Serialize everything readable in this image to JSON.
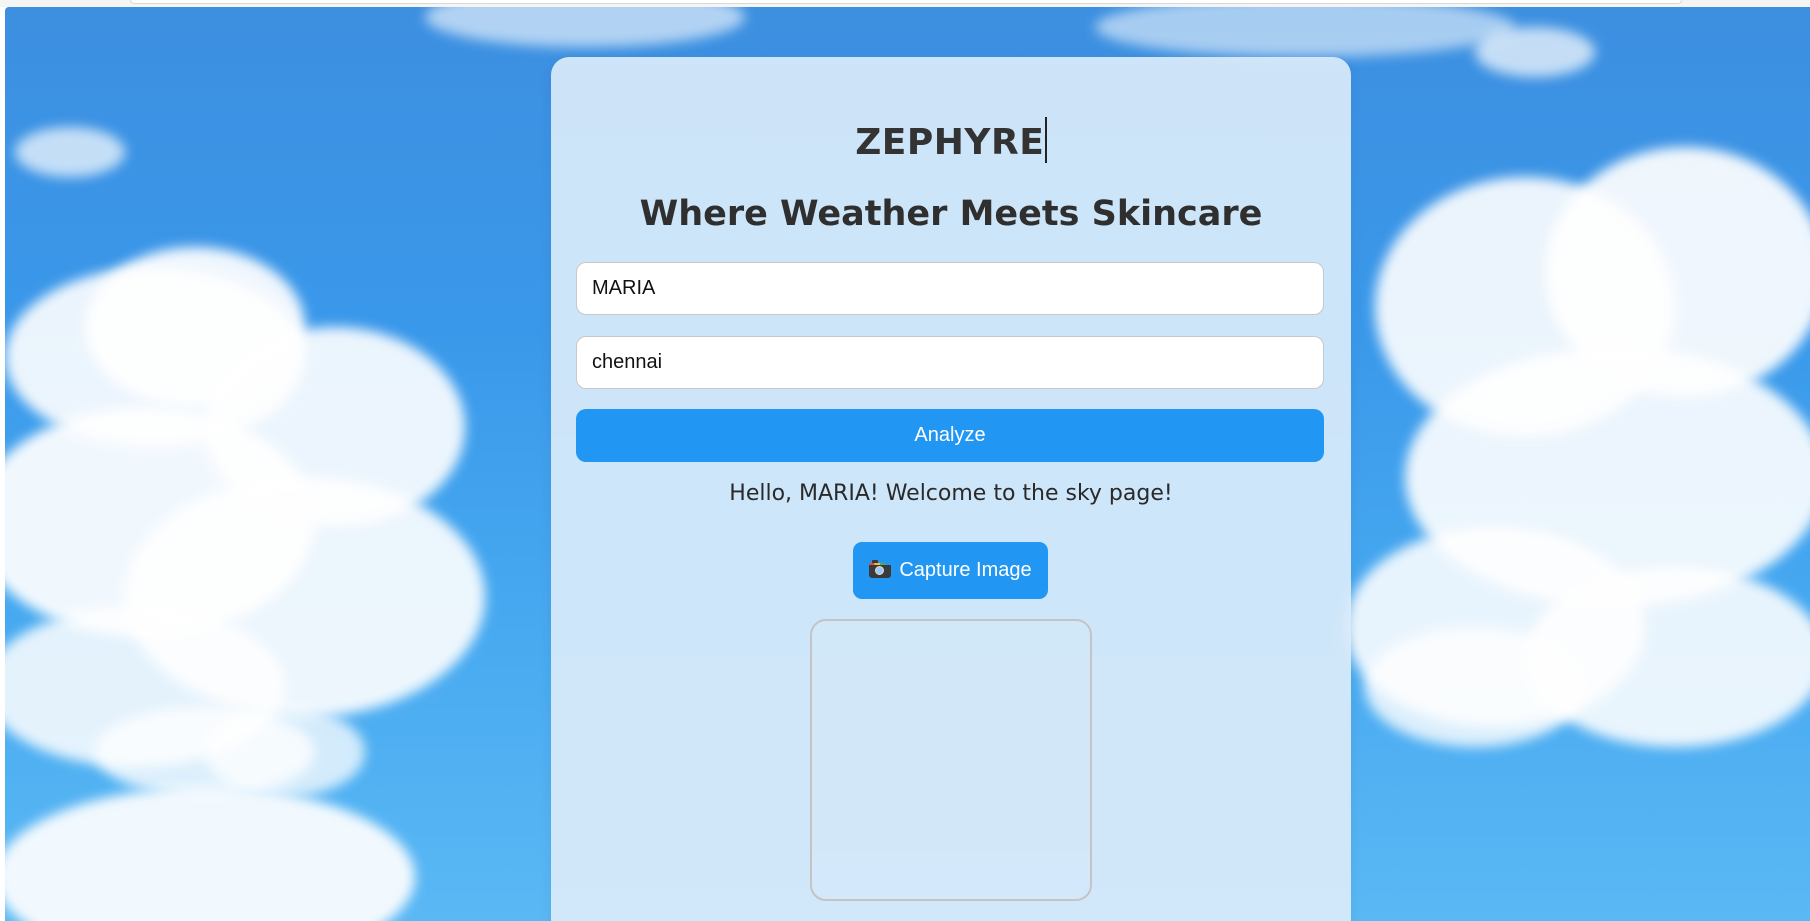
{
  "app": {
    "brand": "ZEPHYRE",
    "tagline": "Where Weather Meets Skincare"
  },
  "form": {
    "name_value": "MARIA",
    "city_value": "chennai",
    "analyze_label": "Analyze"
  },
  "greeting": "Hello, MARIA! Welcome to the sky page!",
  "capture": {
    "label": "Capture Image",
    "icon": "camera-icon"
  },
  "colors": {
    "accent": "#2196f3",
    "sky": "#3a98ea",
    "card": "#daecfa",
    "text": "#333333"
  }
}
